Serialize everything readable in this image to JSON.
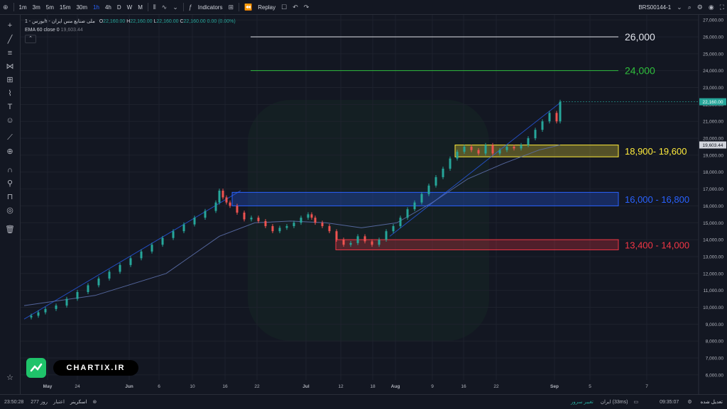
{
  "toolbar": {
    "timeframes": [
      "1m",
      "3m",
      "5m",
      "15m",
      "30m",
      "1h",
      "4h",
      "D",
      "W",
      "M"
    ],
    "active_timeframe": "1h",
    "indicators_label": "Indicators",
    "replay_label": "Replay",
    "symbol": "BRS00144-1"
  },
  "legend": {
    "title": "بورس - 1h - ملی صنایع مس ایران",
    "o_label": "O",
    "o": "22,160.00",
    "h_label": "H",
    "h": "22,160.00",
    "l_label": "L",
    "l": "22,160.00",
    "c_label": "C",
    "c": "22,160.00",
    "change": "0.00 (0.00%)",
    "ema_label": "EMA 60 close 0",
    "ema_value": "19,603.44"
  },
  "logo": {
    "text": "CHARTIX.IR"
  },
  "bottombar": {
    "left_time": "23:50:28",
    "left_text1": "277 روز",
    "left_text2": "اعتبار",
    "left_text3": "اسکرینر",
    "center_text": "تغییر سرور",
    "server": "ایران (33ms)",
    "right_time": "09:35:07",
    "right_text": "تعدیل شده"
  },
  "colors": {
    "background": "#131722",
    "up": "#26a69a",
    "down": "#ef5350",
    "ema": "#5b6ea8",
    "trend": "#2962ff",
    "level_white": "#e0e3eb",
    "level_green": "#2fbf3c",
    "zone_yellow": "#ffeb3b",
    "zone_blue": "#2962ff",
    "zone_red": "#f23645"
  },
  "chart_data": {
    "type": "candlestick",
    "x_tick_labels": [
      "May",
      "24",
      "Jun",
      "6",
      "10",
      "16",
      "22",
      "Jul",
      "12",
      "18",
      "Aug",
      "9",
      "16",
      "22",
      "Sep",
      "5",
      "7"
    ],
    "y_tick_labels": [
      "6,000.00",
      "7,000.00",
      "8,000.00",
      "9,000.00",
      "10,000.00",
      "11,000.00",
      "12,000.00",
      "13,000.00",
      "14,000.00",
      "15,000.00",
      "16,000.00",
      "17,000.00",
      "18,000.00",
      "19,000.00",
      "20,000.00",
      "21,000.00",
      "22,000.00",
      "23,000.00",
      "24,000.00",
      "25,000.00",
      "26,000.00",
      "27,000.00"
    ],
    "y_range": [
      5700,
      27300
    ],
    "last_price": "22,160.00",
    "ema_value": "19,603.44",
    "levels": [
      {
        "label": "26,000",
        "value": 26000,
        "color": "#e0e3eb"
      },
      {
        "label": "24,000",
        "value": 24000,
        "color": "#2fbf3c"
      }
    ],
    "zones": [
      {
        "label": "18,900- 19,600",
        "low": 18900,
        "high": 19600,
        "color": "#ffeb3b"
      },
      {
        "label": "16,000 - 16,800",
        "low": 16000,
        "high": 16800,
        "color": "#2962ff"
      },
      {
        "label": "13,400 - 14,000",
        "low": 13400,
        "high": 14000,
        "color": "#f23645"
      }
    ],
    "price_series": [
      [
        0,
        9400
      ],
      [
        2,
        9500
      ],
      [
        4,
        9700
      ],
      [
        6,
        9900
      ],
      [
        9,
        10100
      ],
      [
        12,
        10500
      ],
      [
        15,
        10900
      ],
      [
        18,
        11300
      ],
      [
        21,
        11700
      ],
      [
        24,
        12100
      ],
      [
        27,
        12500
      ],
      [
        30,
        12900
      ],
      [
        33,
        13300
      ],
      [
        36,
        13700
      ],
      [
        39,
        14100
      ],
      [
        42,
        14500
      ],
      [
        45,
        14900
      ],
      [
        48,
        15300
      ],
      [
        51,
        15700
      ],
      [
        54,
        16200
      ],
      [
        55,
        16900
      ],
      [
        56,
        16500
      ],
      [
        57,
        16200
      ],
      [
        58,
        16000
      ],
      [
        60,
        15600
      ],
      [
        62,
        15200
      ],
      [
        64,
        15300
      ],
      [
        66,
        15100
      ],
      [
        68,
        14800
      ],
      [
        70,
        14500
      ],
      [
        72,
        14700
      ],
      [
        74,
        14800
      ],
      [
        76,
        15000
      ],
      [
        78,
        15300
      ],
      [
        80,
        15500
      ],
      [
        81,
        15300
      ],
      [
        82,
        15000
      ],
      [
        84,
        14800
      ],
      [
        86,
        14500
      ],
      [
        88,
        14000
      ],
      [
        90,
        13700
      ],
      [
        92,
        13800
      ],
      [
        94,
        14200
      ],
      [
        96,
        13900
      ],
      [
        98,
        13700
      ],
      [
        100,
        14000
      ],
      [
        102,
        14500
      ],
      [
        104,
        14800
      ],
      [
        106,
        15300
      ],
      [
        108,
        15800
      ],
      [
        110,
        16200
      ],
      [
        112,
        16700
      ],
      [
        114,
        17200
      ],
      [
        116,
        17700
      ],
      [
        118,
        18200
      ],
      [
        120,
        18800
      ],
      [
        122,
        19200
      ],
      [
        124,
        19500
      ],
      [
        126,
        19300
      ],
      [
        128,
        19100
      ],
      [
        130,
        19600
      ],
      [
        132,
        19100
      ],
      [
        134,
        19300
      ],
      [
        136,
        19500
      ],
      [
        138,
        19400
      ],
      [
        140,
        19600
      ],
      [
        142,
        20000
      ],
      [
        144,
        20500
      ],
      [
        146,
        21000
      ],
      [
        148,
        21500
      ],
      [
        150,
        21000
      ],
      [
        151,
        22160
      ]
    ],
    "ema_series": [
      [
        0,
        10100
      ],
      [
        20,
        10700
      ],
      [
        40,
        12000
      ],
      [
        55,
        14200
      ],
      [
        65,
        15000
      ],
      [
        75,
        15100
      ],
      [
        85,
        15000
      ],
      [
        95,
        14700
      ],
      [
        105,
        15000
      ],
      [
        115,
        16200
      ],
      [
        125,
        17600
      ],
      [
        135,
        18500
      ],
      [
        145,
        19300
      ],
      [
        151,
        19603
      ]
    ]
  }
}
